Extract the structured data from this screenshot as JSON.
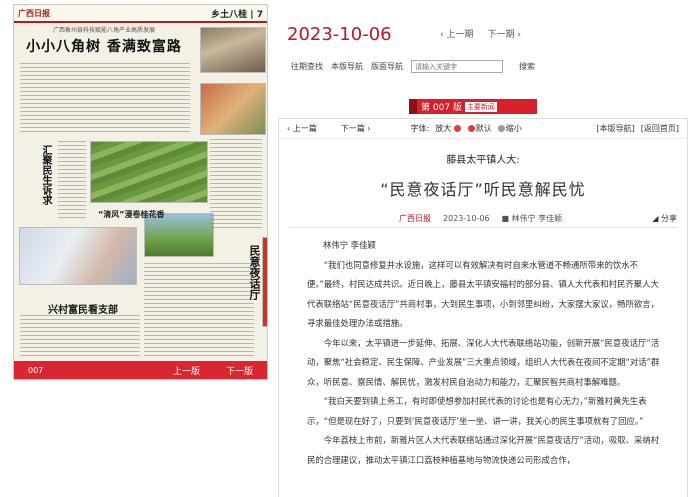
{
  "newspaper": {
    "masthead": "广西日报",
    "section": "乡土八桂",
    "page_num": "7",
    "subhead": "广西象州县科技赋能八角产业高质发展",
    "headline": "小小八角树 香满致富路",
    "col_title_1": "汇聚民生诉求",
    "col_title_2": "“清风”漫卷桂花香",
    "col_title_3": "兴村富民看支部",
    "col_title_4": "民意夜话厅",
    "footer_page": "007",
    "footer_prev": "上一版",
    "footer_next": "下一版"
  },
  "header": {
    "date": "2023-10-06",
    "prev_issue": "上一期",
    "next_issue": "下一期",
    "past_issues": "往期查找",
    "section_nav": "本版导航",
    "page_nav": "版面导航",
    "search_placeholder": "请输入关键字",
    "search_button": "搜索"
  },
  "banner": {
    "label": "第 007 版",
    "category": "主要新闻"
  },
  "article_tools": {
    "prev": "上一篇",
    "next": "下一篇",
    "font_label": "字体:",
    "enlarge": "放大",
    "default": "默认",
    "shrink": "缩小",
    "page_nav": "[本版导航]",
    "home": "[返回首页]"
  },
  "article": {
    "kicker": "藤县太平镇人大:",
    "title": "“民意夜话厅”听民意解民忧",
    "source": "广西日报",
    "date": "2023-10-06",
    "authors_meta": "林伟宁 李佳颖",
    "share": "分享",
    "byline": "林伟宁 李佳颖",
    "paragraphs": [
      "“我们也同意修复井水设施，这样可以有效解决有时自来水管道不畅通所带来的饮水不便。”最终，村民达成共识。近日晚上，藤县太平镇安福村的部分县、镇人大代表和村民齐聚人大代表联络站“民意夜话厅”共商村事，大到民生事项，小到邻里纠纷，大家摆大家议，畅所欲言，寻求最佳处理办法或措施。",
      "今年以来，太平镇进一步延伸、拓展、深化人大代表联络站功能，创新开展“民意夜话厅”活动，聚焦“社会稳定、民生保障、产业发展”三大重点领域，组织人大代表在夜间不定期“对话”群众，听民意、察民情、解民忧，激发村民自治动力和能力，汇聚民智共商村事解难题。",
      "“我白天要到镇上务工，有时即使想参加村民代表的讨论也是有心无力，”新雅村黄先生表示，“但是现在好了，只要到‘民意夜话厅’坐一坐、讲一讲，我关心的民生事项就有了回应。”",
      "今年荔枝上市前，新雅片区人大代表联络站通过深化开展“民意夜话厅”活动，吸取、采纳村民的合理建议，推动太平镇江口荔枝种植基地与物流快递公司形成合作，"
    ]
  }
}
